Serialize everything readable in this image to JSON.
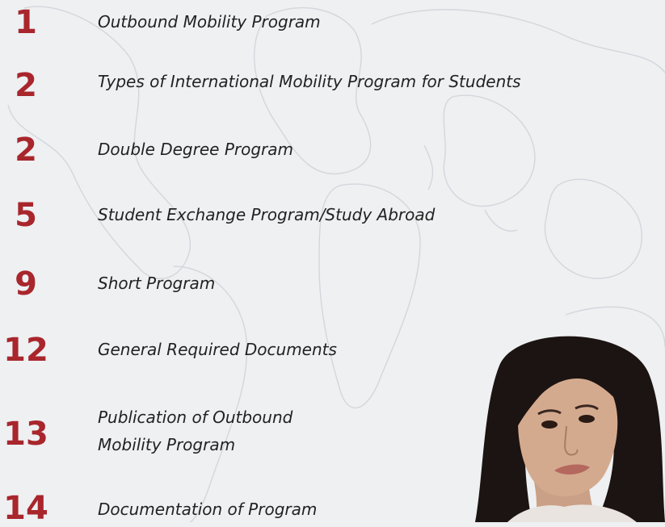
{
  "toc": {
    "entries": [
      {
        "page": "1",
        "title": "Outbound Mobility Program"
      },
      {
        "page": "2",
        "title": "Types of International Mobility Program for Students"
      },
      {
        "page": "2",
        "title": "Double Degree Program"
      },
      {
        "page": "5",
        "title": "Student Exchange Program/Study Abroad"
      },
      {
        "page": "9",
        "title": "Short Program"
      },
      {
        "page": "12",
        "title": "General Required Documents"
      },
      {
        "page": "13",
        "title": "Publication of Outbound\nMobility Program"
      },
      {
        "page": "14",
        "title": "Documentation of Program"
      }
    ]
  },
  "colors": {
    "accent": "#a8262c",
    "text": "#222222",
    "background": "#eef0f2"
  }
}
